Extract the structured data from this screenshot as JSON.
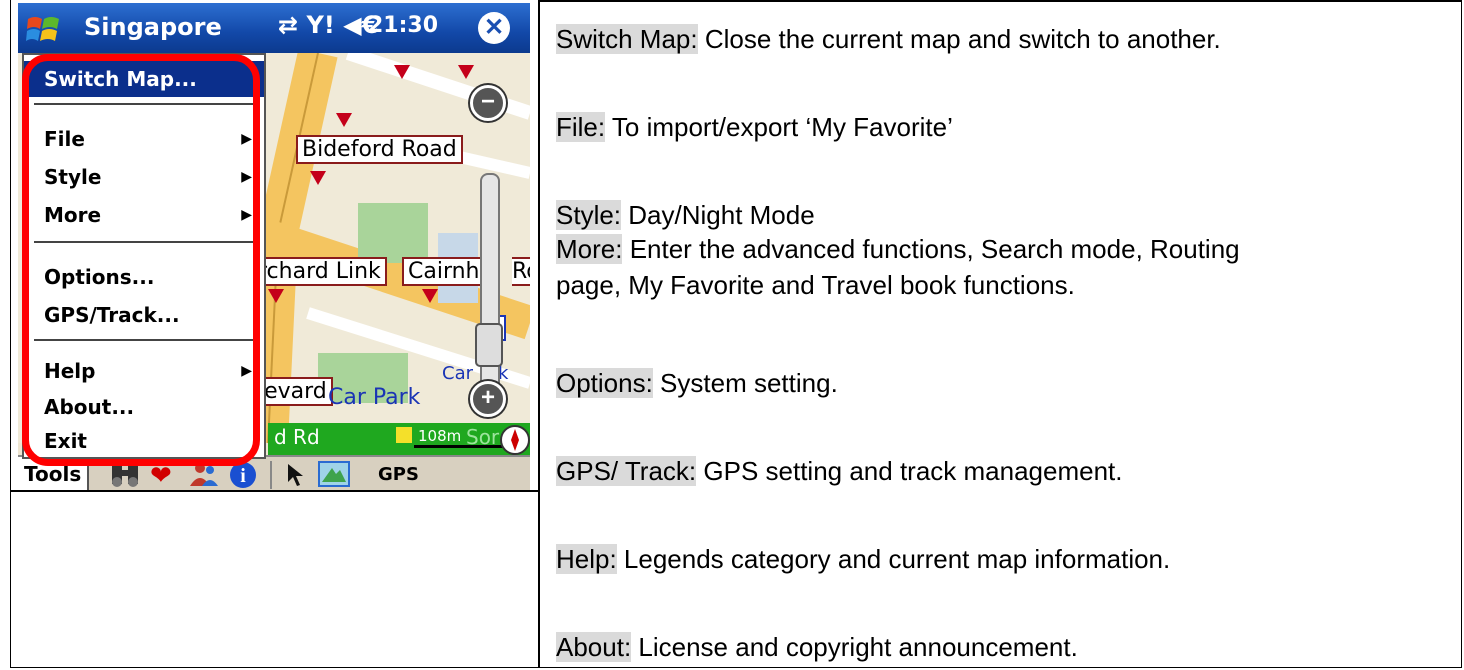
{
  "device": {
    "app_title": "Singapore",
    "status_icons": "⇄ Y! ◀€",
    "clock": "21:30",
    "close_glyph": "✕"
  },
  "map": {
    "labels": [
      "Bideford Road",
      "rchard Link",
      "Cairnhi",
      "Ro",
      "levard",
      "d Rd"
    ],
    "car_parks": [
      "Car Park",
      "Car",
      "k"
    ],
    "scale": "108m",
    "scale_suffix": "Sor"
  },
  "menu": {
    "items": [
      {
        "label": "Switch Map..."
      },
      {
        "label": "File"
      },
      {
        "label": "Style"
      },
      {
        "label": "More"
      },
      {
        "label": "Options..."
      },
      {
        "label": "GPS/Track..."
      },
      {
        "label": "Help"
      },
      {
        "label": "About..."
      },
      {
        "label": "Exit"
      }
    ]
  },
  "toolbar": {
    "tools_label": "Tools",
    "gps_label": "GPS",
    "icons": [
      "binoculars-icon",
      "heart-icon",
      "people-icon",
      "info-icon",
      "cursor-icon",
      "map-view-icon"
    ]
  },
  "descriptions": [
    {
      "key": "Switch Map:",
      "text": " Close the current map and switch to another."
    },
    {
      "key": "File:",
      "text": " To import/export ‘My Favorite’"
    },
    {
      "key": "Style:",
      "text": " Day/Night Mode"
    },
    {
      "key": "More:",
      "text": " Enter the advanced functions, Search mode, Routing"
    },
    {
      "key": "",
      "text": "page, My Favorite and Travel book functions."
    },
    {
      "key": "Options:",
      "text": " System setting."
    },
    {
      "key": "GPS/ Track:",
      "text": " GPS setting and track management."
    },
    {
      "key": "Help:",
      "text": " Legends category and current map information."
    },
    {
      "key": "About:",
      "text": " License and copyright announcement."
    }
  ],
  "colors": {
    "titlebar": "#1248a8",
    "menu_selected": "#0b2f8c",
    "highlight_box": "#ff0000",
    "key_background": "#dadada"
  }
}
